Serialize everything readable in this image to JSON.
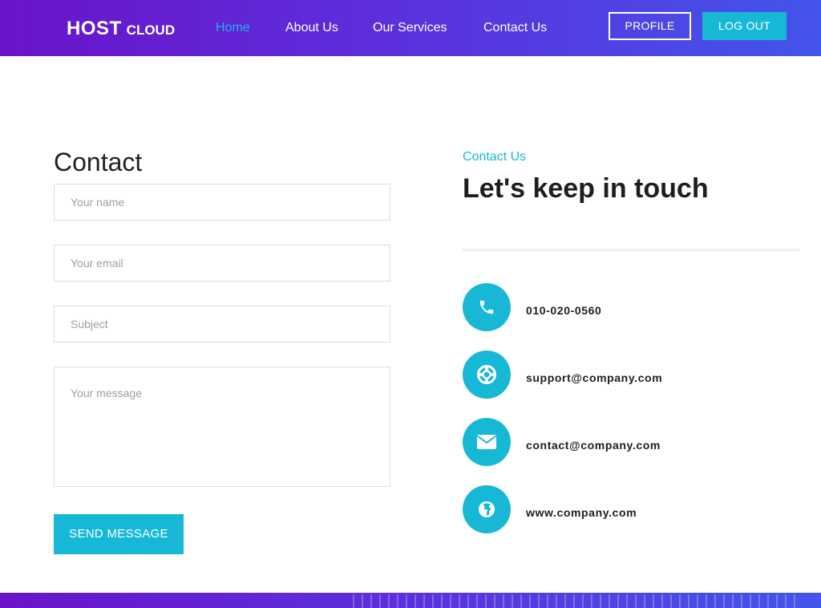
{
  "header": {
    "logo_main": "HOST",
    "logo_sub": "CLOUD",
    "nav": {
      "home": "Home",
      "about": "About Us",
      "services": "Our Services",
      "contact": "Contact Us"
    },
    "active_nav": "home",
    "profile_label": "PROFILE",
    "logout_label": "LOG OUT"
  },
  "form": {
    "title": "Contact",
    "name_placeholder": "Your name",
    "email_placeholder": "Your email",
    "subject_placeholder": "Subject",
    "message_placeholder": "Your message",
    "send_label": "SEND MESSAGE"
  },
  "info": {
    "eyebrow": "Contact Us",
    "headline": "Let's keep in touch",
    "items": [
      {
        "icon": "phone-icon",
        "text": "010-020-0560"
      },
      {
        "icon": "lifebuoy-icon",
        "text": "support@company.com"
      },
      {
        "icon": "envelope-icon",
        "text": "contact@company.com"
      },
      {
        "icon": "globe-icon",
        "text": "www.company.com"
      }
    ]
  },
  "colors": {
    "accent": "#17b8d6",
    "gradient_start": "#6a14c9",
    "gradient_end": "#4355ea",
    "active_nav": "#1fb3ea"
  }
}
